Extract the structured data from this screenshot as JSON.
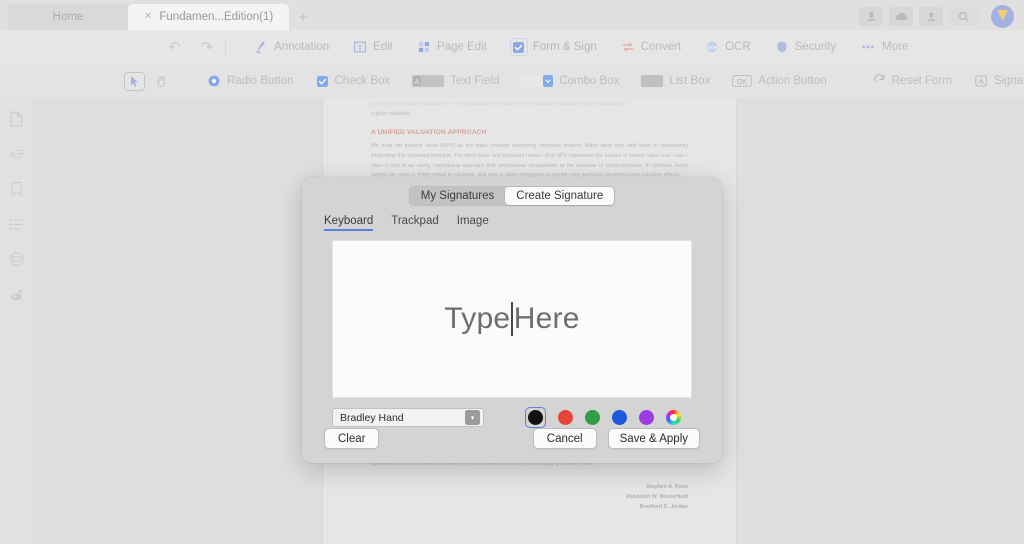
{
  "window": {
    "tabs": [
      {
        "label": "Home",
        "state": "inactive",
        "closable": false
      },
      {
        "label": "Fundamen...Edition(1)",
        "state": "active",
        "closable": true,
        "close_glyph": "✕"
      }
    ],
    "new_tab_glyph": "+",
    "controls": [
      {
        "name": "download-icon",
        "glyph": "⬇"
      },
      {
        "name": "cloud-icon",
        "glyph": "☁"
      },
      {
        "name": "share-icon",
        "glyph": "⬆"
      },
      {
        "name": "search-icon",
        "glyph": "⌕"
      }
    ]
  },
  "toolbar": {
    "undo_label": "↶",
    "redo_label": "↷",
    "items": [
      {
        "label": "Annotation",
        "icon": "pen-icon",
        "active": false
      },
      {
        "label": "Edit",
        "icon": "text-edit-icon",
        "active": false
      },
      {
        "label": "Page Edit",
        "icon": "grid-icon",
        "active": false
      },
      {
        "label": "Form & Sign",
        "icon": "checkbox-icon",
        "active": true
      },
      {
        "label": "Convert",
        "icon": "convert-icon",
        "active": false
      },
      {
        "label": "OCR",
        "icon": "ocr-icon",
        "active": false
      },
      {
        "label": "Security",
        "icon": "shield-icon",
        "active": false
      },
      {
        "label": "More",
        "icon": "ellipsis-icon",
        "active": false
      }
    ]
  },
  "subtoolbar": {
    "cursor_tool": {
      "name": "select-arrow-tool",
      "selected": true
    },
    "hand_tool": {
      "name": "hand-tool",
      "selected": false
    },
    "fields": [
      {
        "label": "Radio Button",
        "icon": "radio-button-icon"
      },
      {
        "label": "Check Box",
        "icon": "check-box-icon"
      },
      {
        "label": "Text Field",
        "icon": "text-field-icon"
      },
      {
        "label": "Combo Box",
        "icon": "combo-box-icon"
      },
      {
        "label": "List Box",
        "icon": "list-box-icon"
      },
      {
        "label": "Action Button",
        "icon": "action-button-icon",
        "badge": "OK"
      }
    ],
    "actions": [
      {
        "label": "Reset Form",
        "icon": "reset-icon"
      },
      {
        "label": "Signature",
        "icon": "signature-icon"
      }
    ]
  },
  "sidebar": {
    "items": [
      {
        "name": "thumbnails-icon"
      },
      {
        "name": "outline-icon"
      },
      {
        "name": "bookmark-icon"
      },
      {
        "name": "annotation-list-icon"
      },
      {
        "name": "stamp-icon"
      },
      {
        "name": "search-doc-icon"
      }
    ]
  },
  "document": {
    "truncated_top": "by way of examples that balance in more abstract terms have a more accurate manager might be practical in",
    "line_after": "a given situation.",
    "heading": "A UNIFIED VALUATION APPROACH",
    "body": "We treat net present value (NPV) as the basic concept underlying corporate finance. Many texts stop well short of consistently integrating this important principle. The most basic and important notion—that NPV represents the excess of market value over cost—often is lost in an overly mechanical approach that emphasizes computation at the expense of comprehension. In contrast, every subject we cover is firmly rooted in valuation, and care is taken throughout to explain how particular decisions have valuation effects.",
    "body2": "flexibility in package options by offering the most extensive collection of teaching, learning, and technology aids of any corporate finance text. Whether you use only the textbook, or the book in conjunction with our other products, we believe you will find a combination with this edition that will meet your current as well as your changing course needs.",
    "authors": [
      "Stephen A. Ross",
      "Randolph W. Westerfield",
      "Bradford D. Jordan"
    ]
  },
  "dialog": {
    "segments": [
      {
        "label": "My Signatures",
        "selected": false
      },
      {
        "label": "Create Signature",
        "selected": true
      }
    ],
    "subtabs": [
      {
        "label": "Keyboard",
        "selected": true
      },
      {
        "label": "Trackpad",
        "selected": false
      },
      {
        "label": "Image",
        "selected": false
      }
    ],
    "canvas": {
      "placeholder_left": "Type",
      "placeholder_right": "Here"
    },
    "font_select": {
      "value": "Bradley Hand",
      "arrow_glyph": "▾"
    },
    "colors": [
      {
        "name": "black",
        "hex": "#111111",
        "selected": true
      },
      {
        "name": "red",
        "hex": "#e7453c",
        "selected": false
      },
      {
        "name": "green",
        "hex": "#2f9e44",
        "selected": false
      },
      {
        "name": "blue",
        "hex": "#1c58d9",
        "selected": false
      },
      {
        "name": "purple",
        "hex": "#9c3cde",
        "selected": false
      },
      {
        "name": "color-wheel",
        "hex": "rainbow",
        "selected": false
      }
    ],
    "buttons": {
      "clear": "Clear",
      "cancel": "Cancel",
      "save": "Save & Apply"
    }
  }
}
